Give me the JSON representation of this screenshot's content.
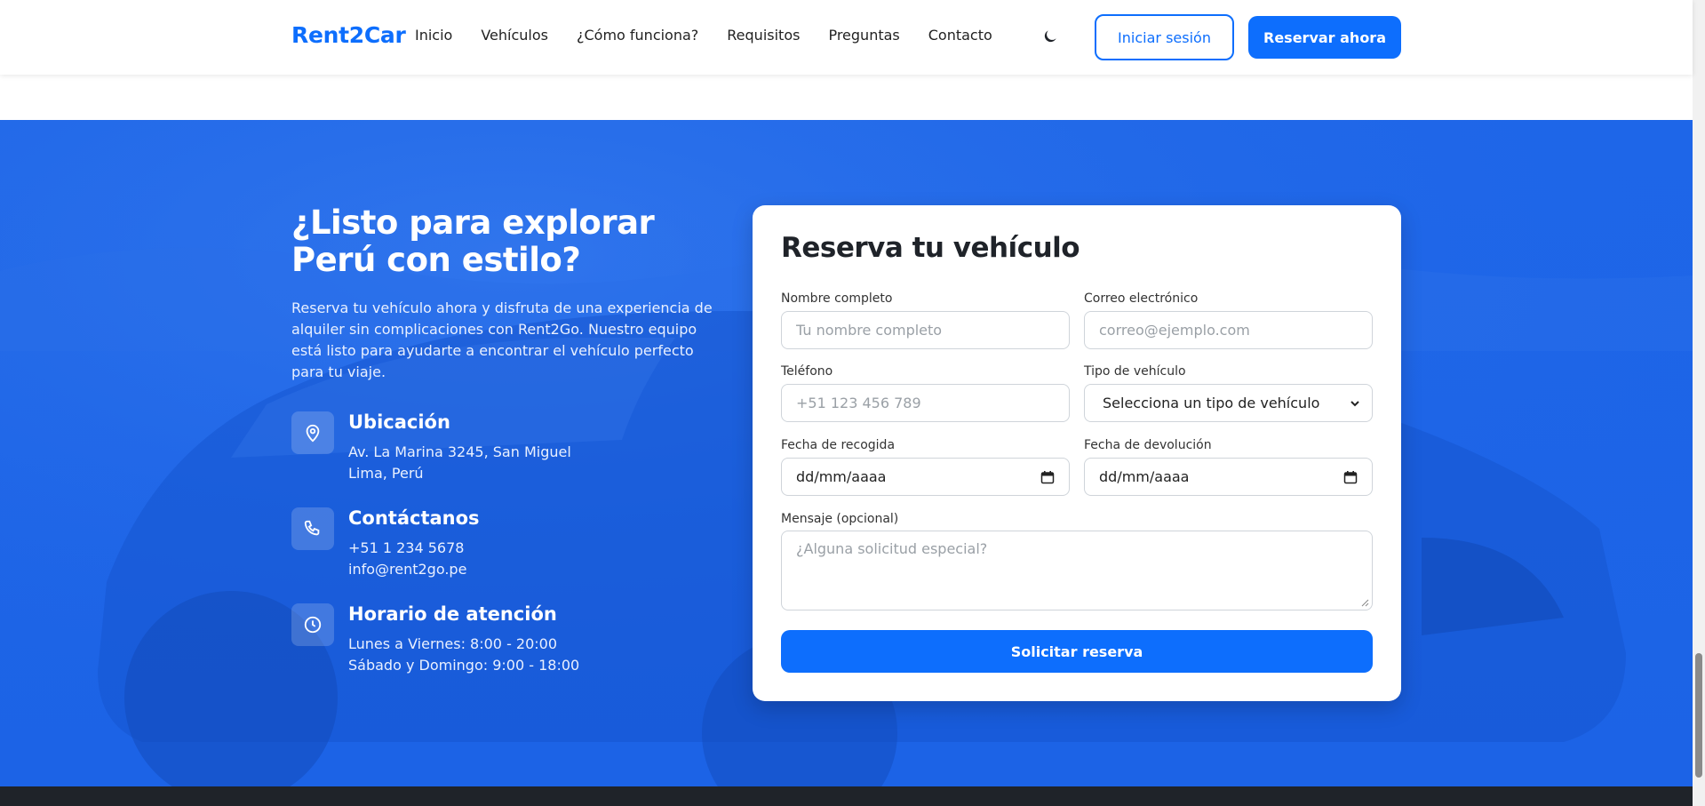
{
  "header": {
    "logo": "Rent2Car",
    "nav": [
      "Inicio",
      "Vehículos",
      "¿Cómo funciona?",
      "Requisitos",
      "Preguntas",
      "Contacto"
    ],
    "theme_icon": "moon-icon",
    "login_label": "Iniciar sesión",
    "reserve_label": "Reservar ahora"
  },
  "hero": {
    "title": "¿Listo para explorar Perú con estilo?",
    "description": "Reserva tu vehículo ahora y disfruta de una experiencia de alquiler sin complicaciones con Rent2Go. Nuestro equipo está listo para ayudarte a encontrar el vehículo perfecto para tu viaje.",
    "info": [
      {
        "icon": "location-pin-icon",
        "title": "Ubicación",
        "lines": [
          "Av. La Marina 3245, San Miguel",
          "Lima, Perú"
        ]
      },
      {
        "icon": "phone-icon",
        "title": "Contáctanos",
        "lines": [
          "+51 1 234 5678",
          "info@rent2go.pe"
        ]
      },
      {
        "icon": "clock-icon",
        "title": "Horario de atención",
        "lines": [
          "Lunes a Viernes: 8:00 - 20:00",
          "Sábado y Domingo: 9:00 - 18:00"
        ]
      }
    ]
  },
  "form": {
    "title": "Reserva tu vehículo",
    "name_label": "Nombre completo",
    "name_placeholder": "Tu nombre completo",
    "email_label": "Correo electrónico",
    "email_placeholder": "correo@ejemplo.com",
    "phone_label": "Teléfono",
    "phone_placeholder": "+51 123 456 789",
    "vehicle_label": "Tipo de vehículo",
    "vehicle_selected": "Selecciona un tipo de vehículo",
    "pickup_label": "Fecha de recogida",
    "pickup_value": "dd/mm/aaaa",
    "return_label": "Fecha de devolución",
    "return_value": "dd/mm/aaaa",
    "message_label": "Mensaje (opcional)",
    "message_placeholder": "¿Alguna solicitud especial?",
    "submit_label": "Solicitar reserva"
  },
  "colors": {
    "primary": "#0d6efd",
    "hero_blue": "#1e66e8",
    "footer": "#1f2329"
  }
}
